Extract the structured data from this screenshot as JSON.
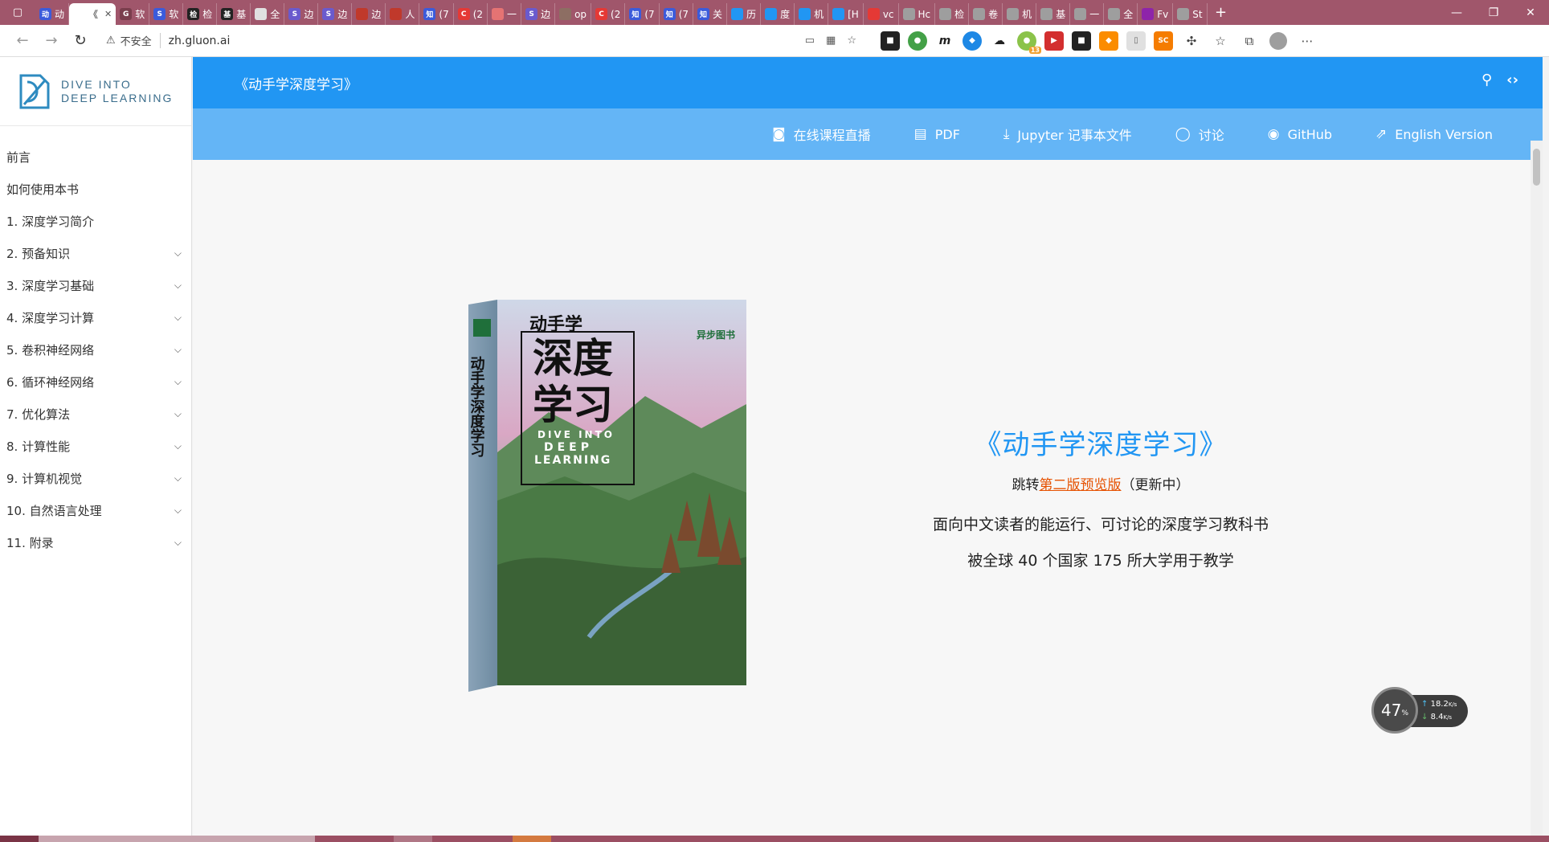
{
  "browser": {
    "tabs": [
      {
        "label": "动",
        "color": "#3b5bdb",
        "glyph": "动",
        "active": false
      },
      {
        "label": "《",
        "color": "#ffffff",
        "glyph": "",
        "active": true
      },
      {
        "label": "软",
        "color": "#7a3e4d",
        "glyph": "G",
        "active": false
      },
      {
        "label": "软",
        "color": "#3b5bdb",
        "glyph": "S",
        "active": false
      },
      {
        "label": "检",
        "color": "#222222",
        "glyph": "检",
        "active": false
      },
      {
        "label": "基",
        "color": "#222222",
        "glyph": "基",
        "active": false
      },
      {
        "label": "全",
        "color": "#e0e0e0",
        "glyph": "",
        "active": false
      },
      {
        "label": "边",
        "color": "#6a5acd",
        "glyph": "S",
        "active": false
      },
      {
        "label": "边",
        "color": "#6a5acd",
        "glyph": "S",
        "active": false
      },
      {
        "label": "边",
        "color": "#c0392b",
        "glyph": "",
        "active": false
      },
      {
        "label": "人",
        "color": "#c0392b",
        "glyph": "",
        "active": false
      },
      {
        "label": "(7",
        "color": "#3b5bdb",
        "glyph": "知",
        "active": false
      },
      {
        "label": "(2",
        "color": "#e53935",
        "glyph": "C",
        "active": false
      },
      {
        "label": "一",
        "color": "#e57373",
        "glyph": "",
        "active": false
      },
      {
        "label": "边",
        "color": "#6a5acd",
        "glyph": "S",
        "active": false
      },
      {
        "label": "op",
        "color": "#8d6e63",
        "glyph": "",
        "active": false
      },
      {
        "label": "(2",
        "color": "#e53935",
        "glyph": "C",
        "active": false
      },
      {
        "label": "(7",
        "color": "#3b5bdb",
        "glyph": "知",
        "active": false
      },
      {
        "label": "(7",
        "color": "#3b5bdb",
        "glyph": "知",
        "active": false
      },
      {
        "label": "关",
        "color": "#3b5bdb",
        "glyph": "知",
        "active": false
      },
      {
        "label": "历",
        "color": "#2196f3",
        "glyph": "",
        "active": false
      },
      {
        "label": "度",
        "color": "#2196f3",
        "glyph": "",
        "active": false
      },
      {
        "label": "机",
        "color": "#2196f3",
        "glyph": "",
        "active": false
      },
      {
        "label": "[H",
        "color": "#2196f3",
        "glyph": "",
        "active": false
      },
      {
        "label": "vc",
        "color": "#e53935",
        "glyph": "",
        "active": false
      },
      {
        "label": "Hc",
        "color": "#9e9e9e",
        "glyph": "",
        "active": false
      },
      {
        "label": "检",
        "color": "#9e9e9e",
        "glyph": "",
        "active": false
      },
      {
        "label": "卷",
        "color": "#9e9e9e",
        "glyph": "",
        "active": false
      },
      {
        "label": "机",
        "color": "#9e9e9e",
        "glyph": "",
        "active": false
      },
      {
        "label": "基",
        "color": "#9e9e9e",
        "glyph": "",
        "active": false
      },
      {
        "label": "一",
        "color": "#9e9e9e",
        "glyph": "",
        "active": false
      },
      {
        "label": "全",
        "color": "#9e9e9e",
        "glyph": "",
        "active": false
      },
      {
        "label": "Fv",
        "color": "#8e24aa",
        "glyph": "",
        "active": false
      },
      {
        "label": "St",
        "color": "#9e9e9e",
        "glyph": "",
        "active": false
      }
    ],
    "window_controls": {
      "minimize": "—",
      "restore": "❐",
      "close": "✕"
    },
    "address": {
      "insecure_label": "不安全",
      "url": "zh.gluon.ai"
    }
  },
  "logo": {
    "line1": "DIVE INTO",
    "line2": "DEEP LEARNING"
  },
  "toc": [
    {
      "label": "前言",
      "expandable": false
    },
    {
      "label": "如何使用本书",
      "expandable": false
    },
    {
      "label": "1. 深度学习简介",
      "expandable": false
    },
    {
      "label": "2. 预备知识",
      "expandable": true
    },
    {
      "label": "3. 深度学习基础",
      "expandable": true
    },
    {
      "label": "4. 深度学习计算",
      "expandable": true
    },
    {
      "label": "5. 卷积神经网络",
      "expandable": true
    },
    {
      "label": "6. 循环神经网络",
      "expandable": true
    },
    {
      "label": "7. 优化算法",
      "expandable": true
    },
    {
      "label": "8. 计算性能",
      "expandable": true
    },
    {
      "label": "9. 计算机视觉",
      "expandable": true
    },
    {
      "label": "10. 自然语言处理",
      "expandable": true
    },
    {
      "label": "11. 附录",
      "expandable": true
    }
  ],
  "header": {
    "title": "《动手学深度学习》",
    "nav": [
      {
        "label": "在线课程直播",
        "icon": "presenter-icon"
      },
      {
        "label": "PDF",
        "icon": "pdf-icon"
      },
      {
        "label": "Jupyter 记事本文件",
        "icon": "download-icon"
      },
      {
        "label": "讨论",
        "icon": "discuss-icon"
      },
      {
        "label": "GitHub",
        "icon": "github-icon"
      },
      {
        "label": "English Version",
        "icon": "external-link-icon"
      }
    ]
  },
  "hero": {
    "title": "《动手学深度学习》",
    "jump_prefix": "跳转",
    "jump_link": "第二版预览版",
    "jump_suffix": "（更新中）",
    "desc1": "面向中文读者的能运行、可讨论的深度学习教科书",
    "desc2": "被全球 40 个国家 175 所大学用于教学"
  },
  "cover": {
    "title_small": "动手学",
    "title_big1": "深度",
    "title_big2": "学习",
    "spine": "动手学深度学习",
    "en1": "DIVE INTO",
    "en2": "DEEP",
    "en3": "LEARNING",
    "publisher": "异步图书"
  },
  "netwidget": {
    "percent": "47",
    "unit": "%",
    "up": "18.2",
    "down": "8.4",
    "rate_unit": "K/s"
  }
}
